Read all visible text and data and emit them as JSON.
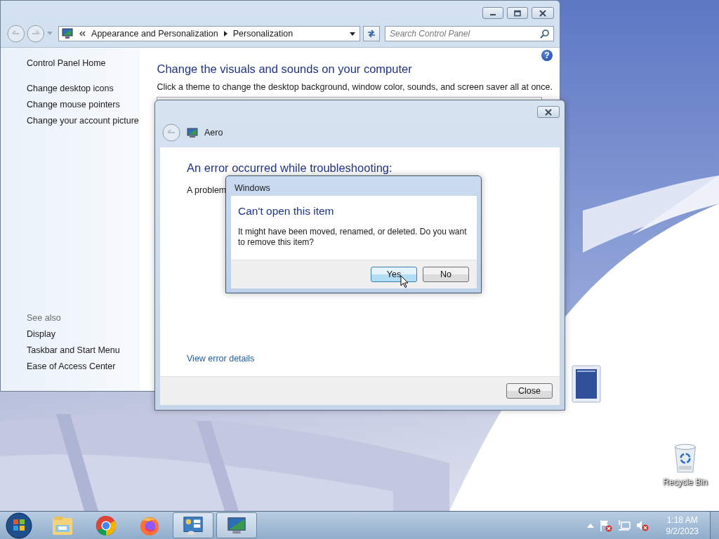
{
  "control_panel": {
    "address_bar": {
      "breadcrumbs": [
        "Appearance and Personalization",
        "Personalization"
      ]
    },
    "search": {
      "placeholder": "Search Control Panel"
    },
    "help_button": "?",
    "sidebar": {
      "home": "Control Panel Home",
      "links": [
        "Change desktop icons",
        "Change mouse pointers",
        "Change your account picture"
      ],
      "see_also_heading": "See also",
      "see_also": [
        "Display",
        "Taskbar and Start Menu",
        "Ease of Access Center"
      ]
    },
    "heading": "Change the visuals and sounds on your computer",
    "description": "Click a theme to change the desktop background, window color, sounds, and screen saver all at once."
  },
  "troubleshooter": {
    "title": "Aero",
    "heading": "An error occurred while troubleshooting:",
    "message": "A problem",
    "details_link": "View error details",
    "close_button": "Close"
  },
  "message_box": {
    "title": "Windows",
    "heading": "Can't open this item",
    "message": "It might have been moved, renamed, or deleted. Do you want to remove this item?",
    "buttons": [
      {
        "label": "Yes",
        "selected": true
      },
      {
        "label": "No",
        "selected": false
      }
    ]
  },
  "desktop_icons": [
    {
      "label": "Recycle Bin"
    }
  ],
  "taskbar": {
    "apps": [
      {
        "kind": "explorer",
        "open": false
      },
      {
        "kind": "chrome",
        "open": false
      },
      {
        "kind": "firefox",
        "open": false
      },
      {
        "kind": "control-panel",
        "open": true
      },
      {
        "kind": "personalization",
        "open": true
      }
    ],
    "clock": {
      "time": "1:18 AM",
      "date": "9/2/2023"
    }
  }
}
